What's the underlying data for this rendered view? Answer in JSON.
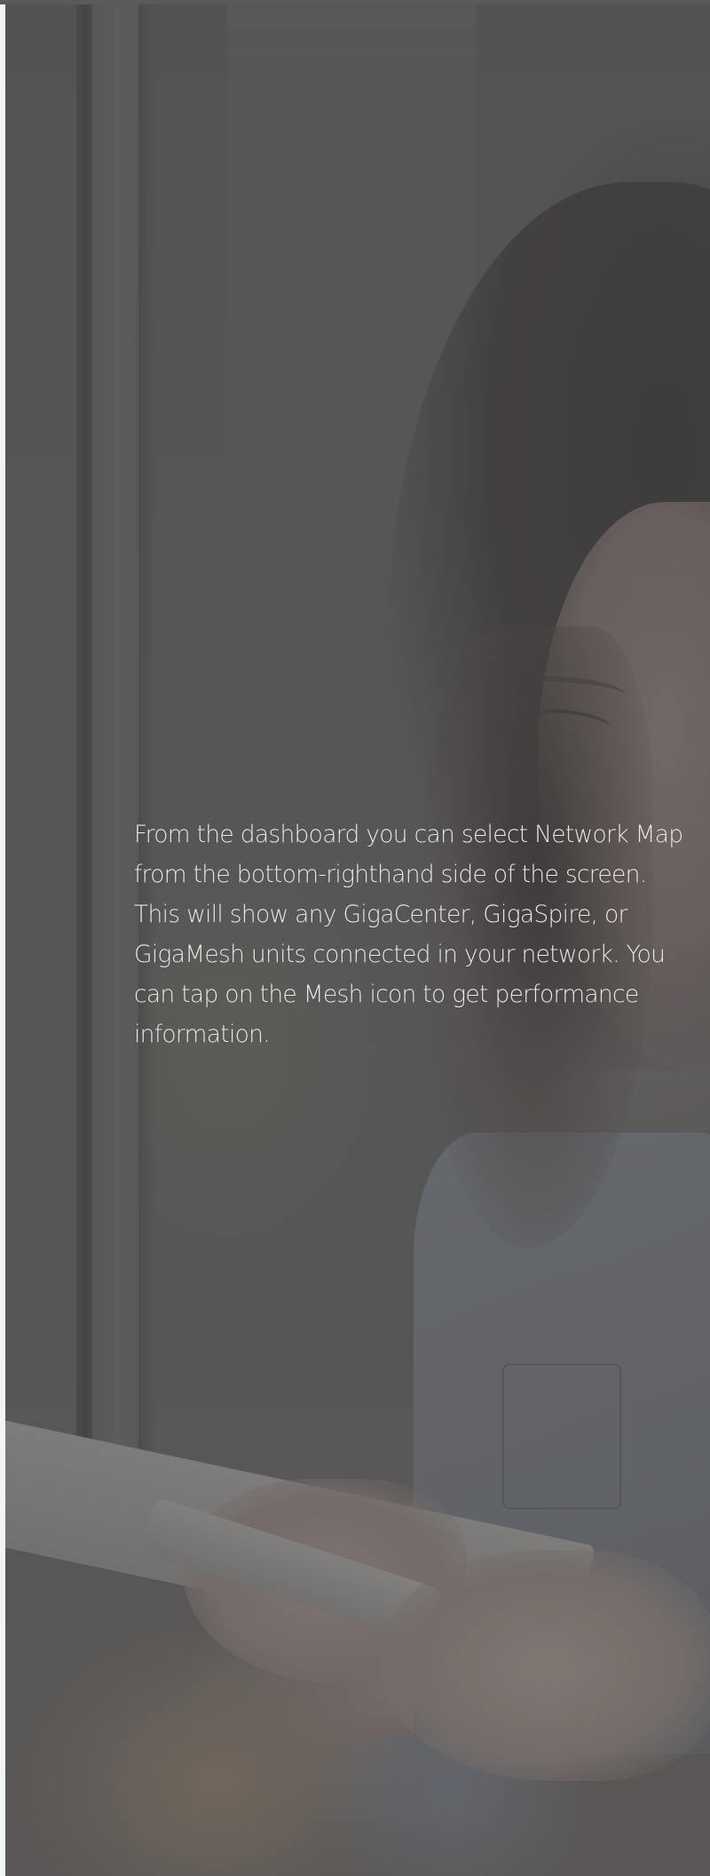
{
  "hero": {
    "image_description_icon": "photo-woman-using-phone",
    "caption": "From the dashboard you can select Network Map from the bottom-righthand side of the screen. This will show any GigaCenter, GigaSpire, or GigaMesh units connected in your network. You can tap on the Mesh icon to get performance information."
  },
  "colors": {
    "overlay": "#565656",
    "caption_text": "#e8e8e8",
    "page_background": "#ffffff"
  }
}
